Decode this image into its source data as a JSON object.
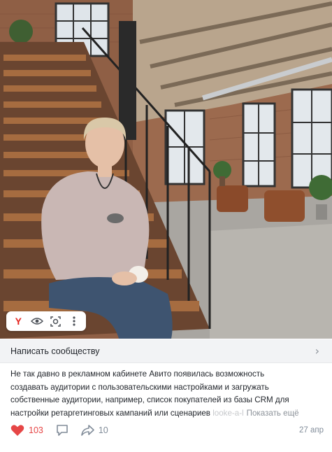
{
  "photo": {
    "icon": "photo-of-woman-on-staircase",
    "toolbar": {
      "icons": [
        "yandex-logo-icon",
        "eye-icon",
        "lens-search-icon",
        "more-vertical-icon"
      ],
      "logo_letter": "Y"
    }
  },
  "community_bar": {
    "label": "Написать сообществу",
    "chevron": "›"
  },
  "post": {
    "lines": [
      "Не так давно в рекламном кабинете Авито появилась возможность",
      "создавать аудитории с пользовательскими настройками и загружать",
      "собственные аудитории, например, список покупателей из базы CRM для",
      "настройки ретаргетинговых кампаний или сценариев "
    ],
    "faded_tail": "looke-a-l",
    "show_more": "Показать ещё"
  },
  "actions": {
    "likes": "103",
    "comments_icon": "comment-icon",
    "shares": "10",
    "date": "27 апр"
  },
  "colors": {
    "like": "#e64646",
    "secondary": "#818c99",
    "bar_bg": "#f2f3f5",
    "yandex_red": "#e52620"
  }
}
